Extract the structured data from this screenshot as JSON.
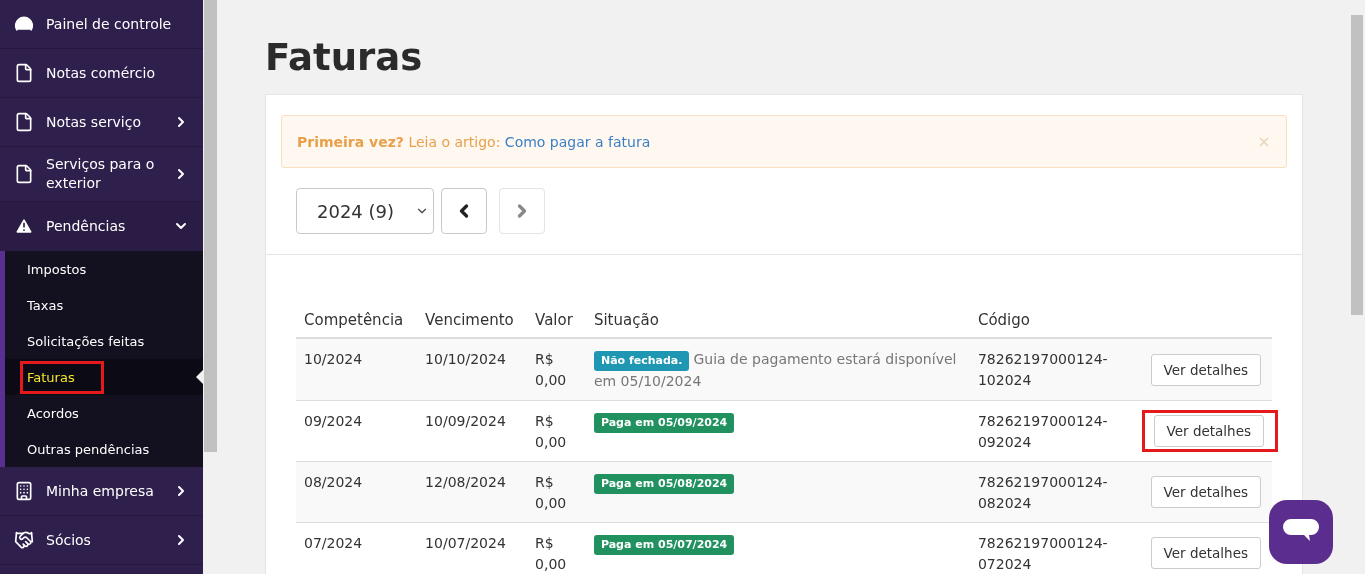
{
  "sidebar": {
    "items": [
      {
        "label": "Painel de controle",
        "has_submenu": false,
        "expanded": false
      },
      {
        "label": "Notas comércio",
        "has_submenu": false,
        "expanded": false
      },
      {
        "label": "Notas serviço",
        "has_submenu": true,
        "expanded": false
      },
      {
        "label": "Serviços para o exterior",
        "has_submenu": true,
        "expanded": false
      },
      {
        "label": "Pendências",
        "has_submenu": true,
        "expanded": true,
        "children": [
          {
            "label": "Impostos",
            "selected": false,
            "highlighted": false
          },
          {
            "label": "Taxas",
            "selected": false,
            "highlighted": false
          },
          {
            "label": "Solicitações feitas",
            "selected": false,
            "highlighted": false
          },
          {
            "label": "Faturas",
            "selected": true,
            "highlighted": true
          },
          {
            "label": "Acordos",
            "selected": false,
            "highlighted": false
          },
          {
            "label": "Outras pendências",
            "selected": false,
            "highlighted": false
          }
        ]
      },
      {
        "label": "Minha empresa",
        "has_submenu": true,
        "expanded": false
      },
      {
        "label": "Sócios",
        "has_submenu": true,
        "expanded": false
      }
    ]
  },
  "page": {
    "title": "Faturas"
  },
  "alert": {
    "lead": "Primeira vez?",
    "text": "Leia o artigo:",
    "link": "Como pagar a fatura"
  },
  "year_select": {
    "value": "2024 (9)"
  },
  "pager": {
    "prev_disabled": false,
    "next_disabled": true
  },
  "table": {
    "columns": [
      "Competência",
      "Vencimento",
      "Valor",
      "Situação",
      "Código"
    ],
    "rows": [
      {
        "competencia": "10/2024",
        "vencimento": "10/10/2024",
        "valor": "R$ 0,00",
        "status": {
          "kind": "info",
          "label": "Não fechada.",
          "note": [
            "Guia de pagamento estará disponível",
            "em 05/10/2024"
          ]
        },
        "codigo": "78262197000124-102024",
        "action": "Ver detalhes",
        "highlighted": false
      },
      {
        "competencia": "09/2024",
        "vencimento": "10/09/2024",
        "valor": "R$ 0,00",
        "status": {
          "kind": "paid",
          "label": "Paga em 05/09/2024"
        },
        "codigo": "78262197000124-092024",
        "action": "Ver detalhes",
        "highlighted": true
      },
      {
        "competencia": "08/2024",
        "vencimento": "12/08/2024",
        "valor": "R$ 0,00",
        "status": {
          "kind": "paid",
          "label": "Paga em 05/08/2024"
        },
        "codigo": "78262197000124-082024",
        "action": "Ver detalhes",
        "highlighted": false
      },
      {
        "competencia": "07/2024",
        "vencimento": "10/07/2024",
        "valor": "R$ 0,00",
        "status": {
          "kind": "paid",
          "label": "Paga em 05/07/2024"
        },
        "codigo": "78262197000124-072024",
        "action": "Ver detalhes",
        "highlighted": false
      }
    ]
  }
}
